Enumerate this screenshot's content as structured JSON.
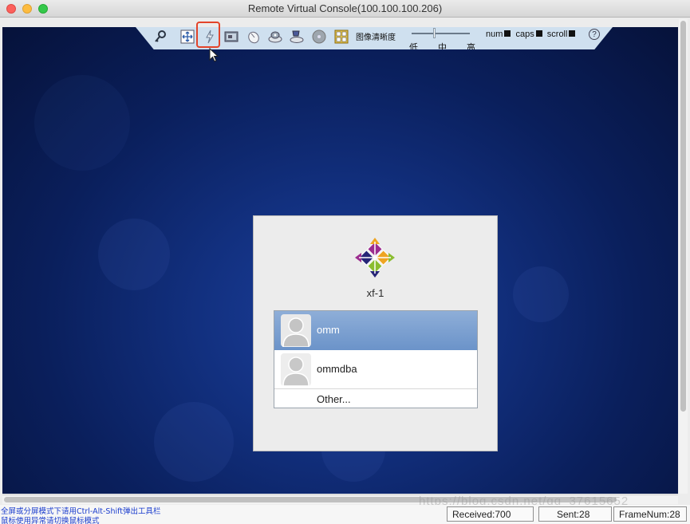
{
  "window": {
    "title": "Remote Virtual Console(100.100.100.206)"
  },
  "toolbar": {
    "icons": [
      "key-icon",
      "move-icon",
      "power-icon",
      "capture-icon",
      "mouse-icon",
      "disk-icon",
      "floppy-icon",
      "cdrom-icon",
      "keyboard-icon"
    ],
    "quality_label": "图像清晰度",
    "quality_levels": [
      "低",
      "中",
      "高"
    ],
    "quality_value": "中",
    "locks": {
      "num": "num",
      "caps": "caps",
      "scroll": "scroll"
    },
    "help_glyph": "?"
  },
  "login": {
    "hostname": "xf-1",
    "users": [
      {
        "name": "omm",
        "selected": true
      },
      {
        "name": "ommdba",
        "selected": false
      }
    ],
    "other_label": "Other..."
  },
  "status": {
    "hint_line1": "全屏或分屏模式下请用Ctrl-Alt-Shift弹出工具栏",
    "hint_line2": "鼠标使用异常请切换鼠标模式",
    "received": "Received:700",
    "sent": "Sent:28",
    "frame_num": "FrameNum:28",
    "watermark": "https://blog.csdn.net/qq_37615652"
  },
  "colors": {
    "highlight": "#e3442a",
    "selection": "#7a9fd0",
    "hint_text": "#1a3ccd"
  }
}
